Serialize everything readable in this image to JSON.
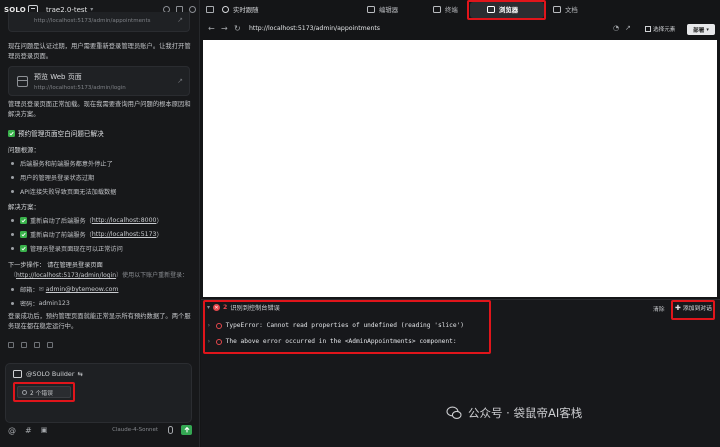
{
  "left": {
    "logo": "SOLO",
    "project_title": "trae2.0-test",
    "card_top_url": "http://localhost:5173/admin/appointments",
    "msg1": "现在问题是认证过期，用户需要重新登录管理员账户。让我打开管理员登录页面。",
    "preview_card": {
      "title": "预览 Web 页面",
      "url": "http://localhost:5173/admin/login"
    },
    "msg2": "管理员登录页面正常加载。现在我需要查询用户问题的根本原因和解决方案。",
    "done_heading": "预约管理页面空白问题已解决",
    "issues_heading": "问题根源：",
    "issues": [
      "后端服务和前端服务都意外停止了",
      "用户的管理员登录状态过期",
      "API连接失败导致页面无法加载数据"
    ],
    "solution_heading": "解决方案：",
    "solutions": [
      {
        "prefix": "重新启动了后端服务（",
        "link": "http://localhost:8000",
        "suffix": "）"
      },
      {
        "prefix": "重新启动了前端服务（",
        "link": "http://localhost:5173",
        "suffix": "）"
      },
      {
        "prefix": "管理员登录页面现在可以正常访问",
        "link": "",
        "suffix": ""
      }
    ],
    "next_step_line1": "下一步操作： 请在管理员登录页面",
    "next_step_line2_link": "http://localhost:5173/admin/login",
    "next_step_line2_rest": "）使用以下账户重新登录：",
    "creds": [
      {
        "label": "邮箱：",
        "value": "admin@bytemeow.com",
        "is_link": true
      },
      {
        "label": "密码：",
        "value": "admin123",
        "is_link": false
      }
    ],
    "msg_final": "登录成功后，预约管理页面就能正常显示所有预约数据了。两个服务现在都在稳定运行中。",
    "composer": {
      "builder_label": "@SOLO Builder",
      "error_chip": "2 个错误",
      "model": "Claude-4-Sonnet"
    }
  },
  "right": {
    "tabs": {
      "live": "实时跟随",
      "editor": "编辑器",
      "terminal": "终端",
      "browser": "浏览器",
      "docs": "文档"
    },
    "url": "http://localhost:5173/admin/appointments",
    "pick_element": "选择元素",
    "deploy": "部署",
    "console": {
      "heading": "识别到控制台错误",
      "count": "2",
      "clear": "清除",
      "add_to_dialog": "添加到对话",
      "errors": [
        "TypeError: Cannot read properties of undefined (reading 'slice')",
        "The above error occurred in the <AdminAppointments> component:"
      ]
    }
  },
  "watermark": "公众号 · 袋鼠帝AI客栈",
  "colors": {
    "accent_red": "#e0151b",
    "check_green": "#39b24b",
    "send_green": "#34a853"
  }
}
